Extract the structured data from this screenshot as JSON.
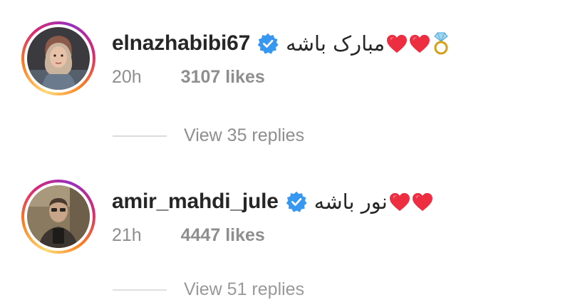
{
  "comments": [
    {
      "username": "elnazhabibi67",
      "verified": true,
      "text": "مبارک باشه",
      "emoji": [
        "heart-icon",
        "heart-icon",
        "ring-icon"
      ],
      "time": "20h",
      "likes": "3107 likes",
      "replies": "View 35 replies"
    },
    {
      "username": "amir_mahdi_jule",
      "verified": true,
      "text": "نور باشه",
      "emoji": [
        "heart-icon",
        "heart-icon"
      ],
      "time": "21h",
      "likes": "4447 likes",
      "replies": "View 51 replies"
    }
  ],
  "colors": {
    "verified": "#3897f0",
    "heart": "#ed2e40",
    "muted": "#8e8e8e"
  }
}
